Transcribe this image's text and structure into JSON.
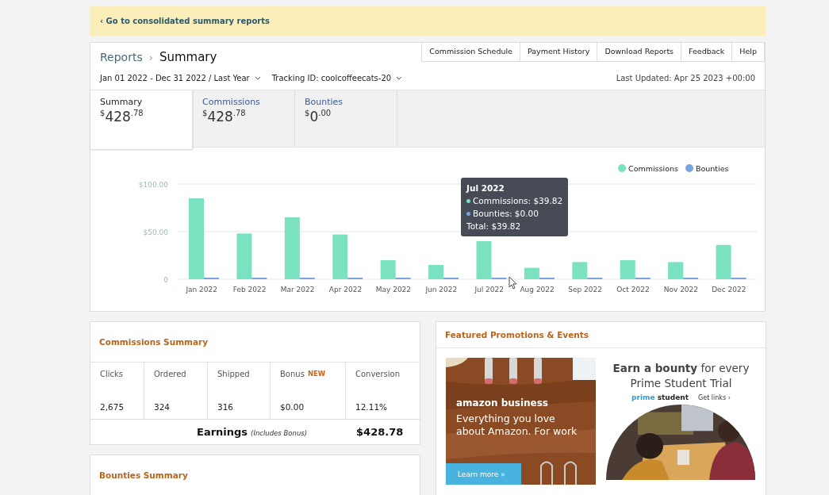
{
  "notice": {
    "link": "‹ Go to consolidated summary reports"
  },
  "breadcrumb": {
    "parent": "Reports",
    "separator": "›",
    "current": "Summary"
  },
  "nav_links": [
    {
      "label": "Commission Schedule"
    },
    {
      "label": "Payment History"
    },
    {
      "label": "Download Reports"
    },
    {
      "label": "Feedback"
    },
    {
      "label": "Help"
    }
  ],
  "filters": {
    "date_range": "Jan 01 2022 - Dec 31 2022 / Last Year",
    "tracking": "Tracking ID: coolcoffeecats-20",
    "last_updated": "Last Updated: Apr 25 2023 +00:00"
  },
  "tabs": [
    {
      "label": "Summary",
      "currency": "$",
      "whole": "428",
      "cents": ".78",
      "selected": true
    },
    {
      "label": "Commissions",
      "currency": "$",
      "whole": "428",
      "cents": ".78",
      "selected": false
    },
    {
      "label": "Bounties",
      "currency": "$",
      "whole": "0",
      "cents": ".00",
      "selected": false
    }
  ],
  "chart": {
    "chart_data": {
      "type": "bar",
      "categories": [
        "Jan 2022",
        "Feb 2022",
        "Mar 2022",
        "Apr 2022",
        "May 2022",
        "Jun 2022",
        "Jul 2022",
        "Aug 2022",
        "Sep 2022",
        "Oct 2022",
        "Nov 2022",
        "Dec 2022"
      ],
      "series": [
        {
          "name": "Commissions",
          "color": "#7ae2c1",
          "values": [
            85,
            48,
            65,
            47,
            20,
            15,
            40,
            12,
            18,
            20,
            18,
            36
          ]
        },
        {
          "name": "Bounties",
          "color": "#7ba3e0",
          "values": [
            0,
            0,
            0,
            0,
            0,
            0,
            0,
            0,
            0,
            0,
            0,
            0
          ]
        }
      ],
      "legend": true,
      "ylim": [
        0,
        100
      ],
      "yticks": [
        {
          "value": 0,
          "label": "0"
        },
        {
          "value": 50,
          "label": "$50.00"
        },
        {
          "value": 100,
          "label": "$100.00"
        }
      ]
    },
    "tooltip": {
      "title": "Jul 2022",
      "lines": [
        "Commissions: $39.82",
        "Bounties: $0.00"
      ],
      "total": "Total: $39.82"
    }
  },
  "commissions_summary": {
    "title": "Commissions Summary",
    "columns": [
      {
        "label": "Clicks",
        "value": "2,675"
      },
      {
        "label": "Ordered",
        "value": "324"
      },
      {
        "label": "Shipped",
        "value": "316"
      },
      {
        "label": "Bonus",
        "badge": "NEW",
        "value": "$0.00"
      },
      {
        "label": "Conversion",
        "value": "12.11%"
      }
    ],
    "earnings_label": "Earnings",
    "earnings_note": "(Includes Bonus)",
    "earnings_value": "$428.78"
  },
  "bounties_summary": {
    "title": "Bounties Summary"
  },
  "promotions": {
    "title": "Featured Promotions & Events",
    "business": {
      "brand": "amazon business",
      "text": "Everything you love about Amazon. For work",
      "button": "Learn more »"
    },
    "student": {
      "headline": "**Earn a bounty** for every Prime Student Trial",
      "brand_a": "prime",
      "brand_b": "student",
      "link": "Get links ›"
    }
  }
}
